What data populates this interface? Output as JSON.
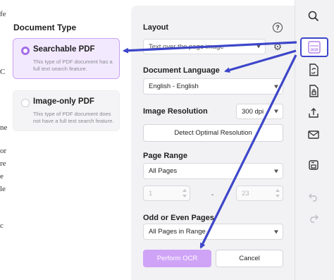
{
  "background_doc": {
    "glyphs": [
      "fe",
      "C",
      "ne",
      "or",
      "re",
      "e",
      "le",
      "c"
    ]
  },
  "document_type": {
    "title": "Document Type",
    "options": [
      {
        "label": "Searchable PDF",
        "description": "This type of PDF document has a full text search feature.",
        "selected": true
      },
      {
        "label": "Image-only PDF",
        "description": "This type of PDF document does not have a full text search feature.",
        "selected": false
      }
    ]
  },
  "layout": {
    "label": "Layout",
    "value": "Text over the page image"
  },
  "document_language": {
    "label": "Document Language",
    "value": "English - English"
  },
  "image_resolution": {
    "label": "Image Resolution",
    "value": "300 dpi",
    "detect_button": "Detect Optimal Resolution"
  },
  "page_range": {
    "label": "Page Range",
    "value": "All Pages",
    "from": "1",
    "to": "23",
    "separator": "-"
  },
  "odd_even": {
    "label": "Odd or Even Pages",
    "value": "All Pages in Range"
  },
  "actions": {
    "perform": "Perform OCR",
    "cancel": "Cancel"
  },
  "toolbar": {
    "ocr_icon_text": "OCR",
    "items": [
      "search-icon",
      "ocr-icon",
      "convert-icon",
      "protect-icon",
      "share-icon",
      "email-icon",
      "save-icon",
      "undo-icon",
      "redo-icon"
    ]
  },
  "colors": {
    "accent": "#a46ee8",
    "selected_bg": "#f3e9ff",
    "primary_button": "#cfa4f7",
    "arrow": "#3d46c9"
  }
}
